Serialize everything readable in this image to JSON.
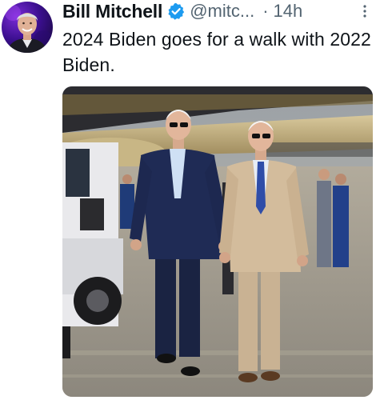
{
  "tweet": {
    "author_name": "Bill Mitchell",
    "handle": "@mitc...",
    "separator": "·",
    "time": "14h",
    "text": "2024 Biden goes for a walk with 2022 Biden.",
    "verified": true,
    "verified_color": "#1d9bf0",
    "icons": {
      "verified": "verified-badge-icon",
      "more": "more-options-icon"
    }
  }
}
